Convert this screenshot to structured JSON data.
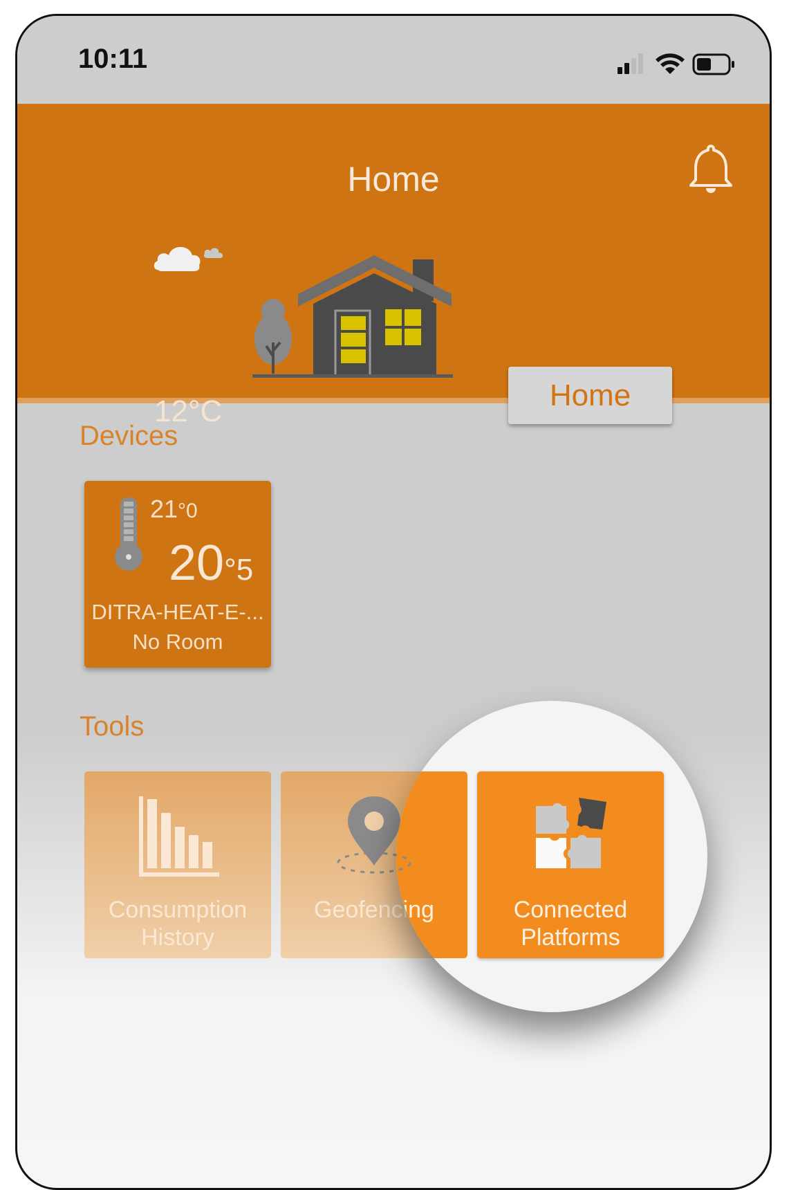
{
  "status_bar": {
    "time": "10:11"
  },
  "header": {
    "title": "Home"
  },
  "weather": {
    "temperature": "12°C"
  },
  "location_button": {
    "label": "Home"
  },
  "devices": {
    "title": "Devices",
    "items": [
      {
        "set_temp": "21",
        "set_temp_decimal": "0",
        "current_temp": "20",
        "current_temp_decimal": "5",
        "name": "DITRA-HEAT-E-...",
        "room": "No Room"
      }
    ]
  },
  "tools": {
    "title": "Tools",
    "items": [
      {
        "label_line1": "Consumption",
        "label_line2": "History"
      },
      {
        "label_line1": "Geofencing",
        "label_line2": ""
      },
      {
        "label_line1": "Connected",
        "label_line2": "Platforms"
      }
    ]
  },
  "colors": {
    "brand_orange": "#cf7413",
    "active_orange": "#f38c1e",
    "background": "#cdcdcd"
  },
  "icons": [
    "cellular-signal-icon",
    "wifi-icon",
    "battery-icon",
    "bell-icon",
    "cloud-icon",
    "house-illustration",
    "thermometer-icon",
    "bar-chart-icon",
    "location-pin-icon",
    "puzzle-icon"
  ]
}
